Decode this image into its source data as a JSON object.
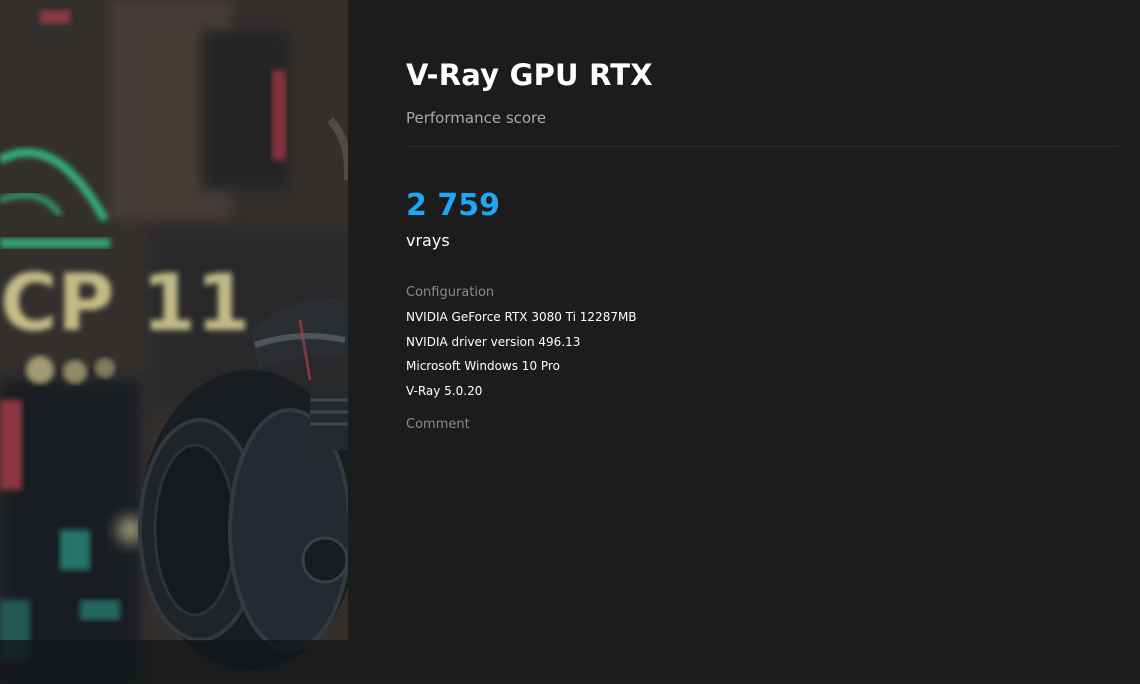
{
  "benchmark": {
    "title": "V-Ray GPU RTX",
    "subtitle": "Performance score",
    "score": "2 759",
    "unit": "vrays"
  },
  "configuration": {
    "label": "Configuration",
    "items": [
      "NVIDIA GeForce RTX 3080 Ti 12287MB",
      "NVIDIA driver version 496.13",
      "Microsoft Windows 10 Pro",
      "V-Ray 5.0.20"
    ]
  },
  "comment": {
    "label": "Comment"
  },
  "colors": {
    "background": "#1c1c1c",
    "score_accent": "#1ea7f5",
    "divider": "#2f2f2f"
  }
}
